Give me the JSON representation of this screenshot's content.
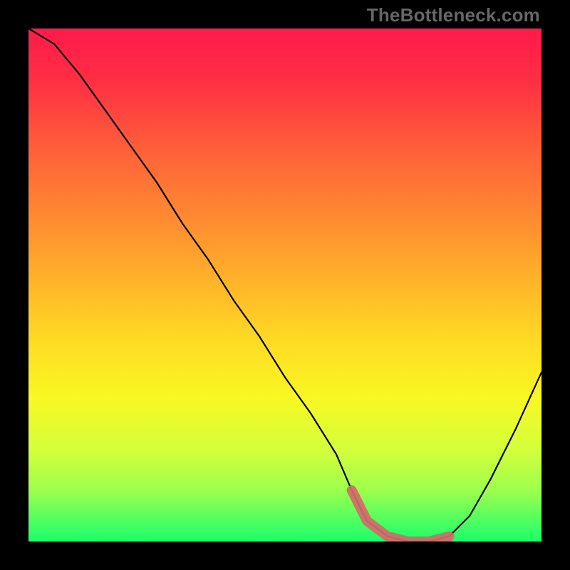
{
  "watermark": "TheBottleneck.com",
  "chart_data": {
    "type": "line",
    "title": "",
    "xlabel": "",
    "ylabel": "",
    "xlim": [
      0,
      100
    ],
    "ylim": [
      0,
      100
    ],
    "grid": false,
    "series": [
      {
        "name": "bottleneck-curve",
        "x": [
          0,
          5,
          10,
          15,
          20,
          25,
          30,
          35,
          40,
          45,
          50,
          55,
          60,
          63,
          66,
          70,
          74,
          78,
          82,
          86,
          90,
          95,
          100
        ],
        "values": [
          100,
          97,
          91,
          84,
          77,
          70,
          62,
          55,
          47,
          40,
          32,
          25,
          17,
          10,
          4,
          1,
          0,
          0,
          1,
          5,
          12,
          22,
          33
        ]
      },
      {
        "name": "highlight-band",
        "x": [
          63,
          66,
          70,
          74,
          78,
          82
        ],
        "values": [
          10,
          4,
          1,
          0,
          0,
          1
        ]
      }
    ],
    "gradient_stops": [
      {
        "offset": 0.0,
        "color": "#ff1a4b"
      },
      {
        "offset": 0.1,
        "color": "#ff2e44"
      },
      {
        "offset": 0.22,
        "color": "#ff5a3a"
      },
      {
        "offset": 0.35,
        "color": "#ff8432"
      },
      {
        "offset": 0.48,
        "color": "#ffaf2a"
      },
      {
        "offset": 0.6,
        "color": "#ffd824"
      },
      {
        "offset": 0.72,
        "color": "#f8f823"
      },
      {
        "offset": 0.82,
        "color": "#d4ff3a"
      },
      {
        "offset": 0.9,
        "color": "#9dff4e"
      },
      {
        "offset": 0.96,
        "color": "#4dff62"
      },
      {
        "offset": 1.0,
        "color": "#1aff6a"
      }
    ],
    "colors": {
      "curve": "#000000",
      "highlight": "#d36a6a"
    }
  }
}
